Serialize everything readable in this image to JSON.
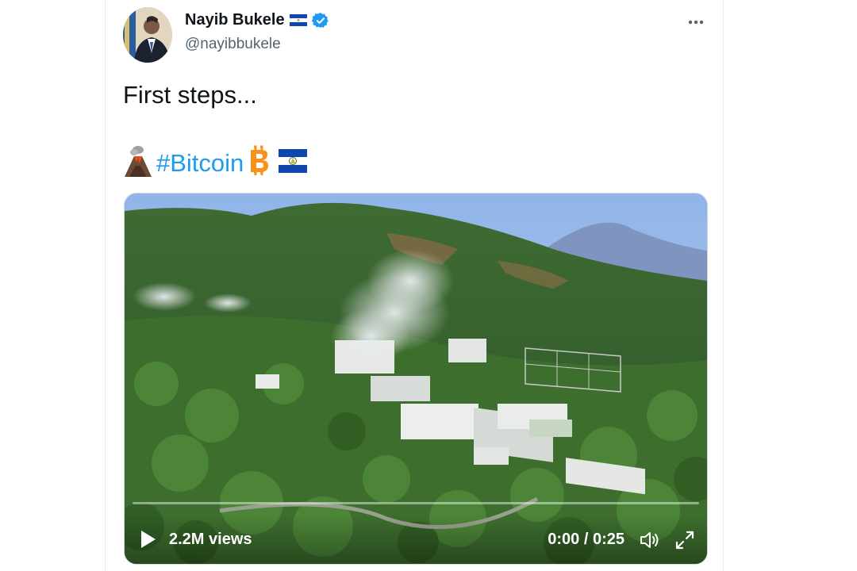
{
  "tweet": {
    "author_name": "Nayib Bukele",
    "author_handle": "@nayibbukele",
    "text": "First steps...",
    "hashtag": "#Bitcoin"
  },
  "video": {
    "views": "2.2M views",
    "time": "0:00 / 0:25",
    "progress": 0
  },
  "icons": {
    "flag": "el-salvador-flag-icon",
    "verified": "verified-badge-icon",
    "more": "more-options-icon",
    "volcano": "volcano-icon",
    "bitcoin": "bitcoin-icon",
    "play": "play-icon",
    "volume": "volume-icon",
    "fullscreen": "fullscreen-icon"
  },
  "colors": {
    "link": "#1d9bf0",
    "text": "#0f1419",
    "muted": "#536471",
    "bitcoin": "#f7931a"
  }
}
